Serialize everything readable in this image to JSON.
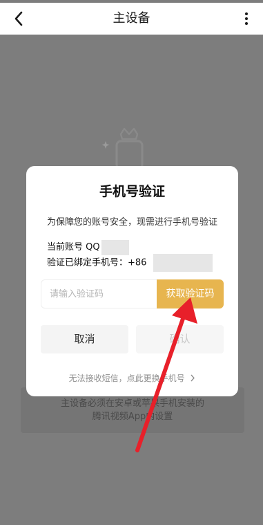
{
  "header": {
    "title": "主设备",
    "back_icon": "chevron-left-icon",
    "more_icon": "more-vertical-icon"
  },
  "background": {
    "illustration_icon": "vip-crown-icon",
    "note_line1": "主设备必须在安卓或苹果手机安装的",
    "note_line2": "腾讯视频App内设置"
  },
  "dialog": {
    "title": "手机号验证",
    "description": "为保障您的账号安全，现需进行手机号验证",
    "account_label": "当前账号 QQ",
    "phone_label": "验证已绑定手机号：+86",
    "code_input_placeholder": "请输入验证码",
    "get_code_label": "获取验证码",
    "cancel_label": "取消",
    "confirm_label": "确认",
    "change_phone_text": "无法接收短信，点此更换手机号",
    "change_phone_icon": "chevron-right-icon"
  },
  "colors": {
    "accent": "#e7b54f",
    "overlay": "#7d7d7d",
    "arrow": "#e8202a"
  }
}
